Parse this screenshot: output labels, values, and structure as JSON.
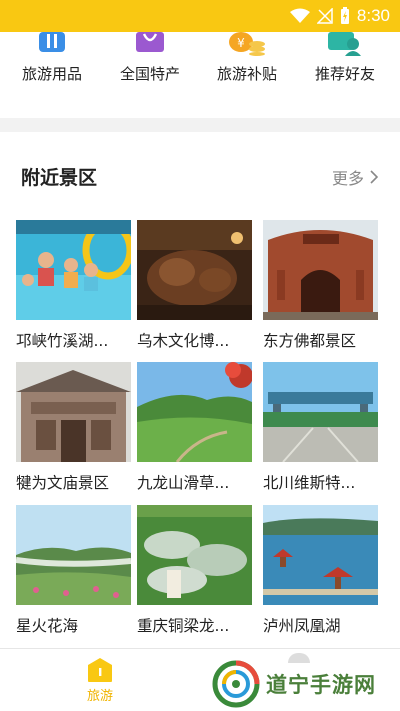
{
  "status_bar": {
    "time": "8:30"
  },
  "categories": [
    {
      "label": "旅游用品",
      "icon": "travel-goods-icon"
    },
    {
      "label": "全国特产",
      "icon": "specialty-bag-icon"
    },
    {
      "label": "旅游补贴",
      "icon": "subsidy-coins-icon"
    },
    {
      "label": "推荐好友",
      "icon": "recommend-friend-icon"
    }
  ],
  "nearby": {
    "title": "附近景区",
    "more_label": "更多",
    "items": [
      {
        "name": "邛峡竹溪湖..."
      },
      {
        "name": "乌木文化博..."
      },
      {
        "name": "东方佛都景区"
      },
      {
        "name": "犍为文庙景区"
      },
      {
        "name": "九龙山滑草..."
      },
      {
        "name": "北川维斯特..."
      },
      {
        "name": "星火花海"
      },
      {
        "name": "重庆铜梁龙..."
      },
      {
        "name": "泸州凤凰湖"
      }
    ]
  },
  "bottom_nav": {
    "home_label": "旅游"
  },
  "watermark": {
    "text": "道宁手游网"
  },
  "colors": {
    "brand_yellow": "#f9c812",
    "icon_blue": "#3a8ee6",
    "tab_active": "#f0b400"
  }
}
